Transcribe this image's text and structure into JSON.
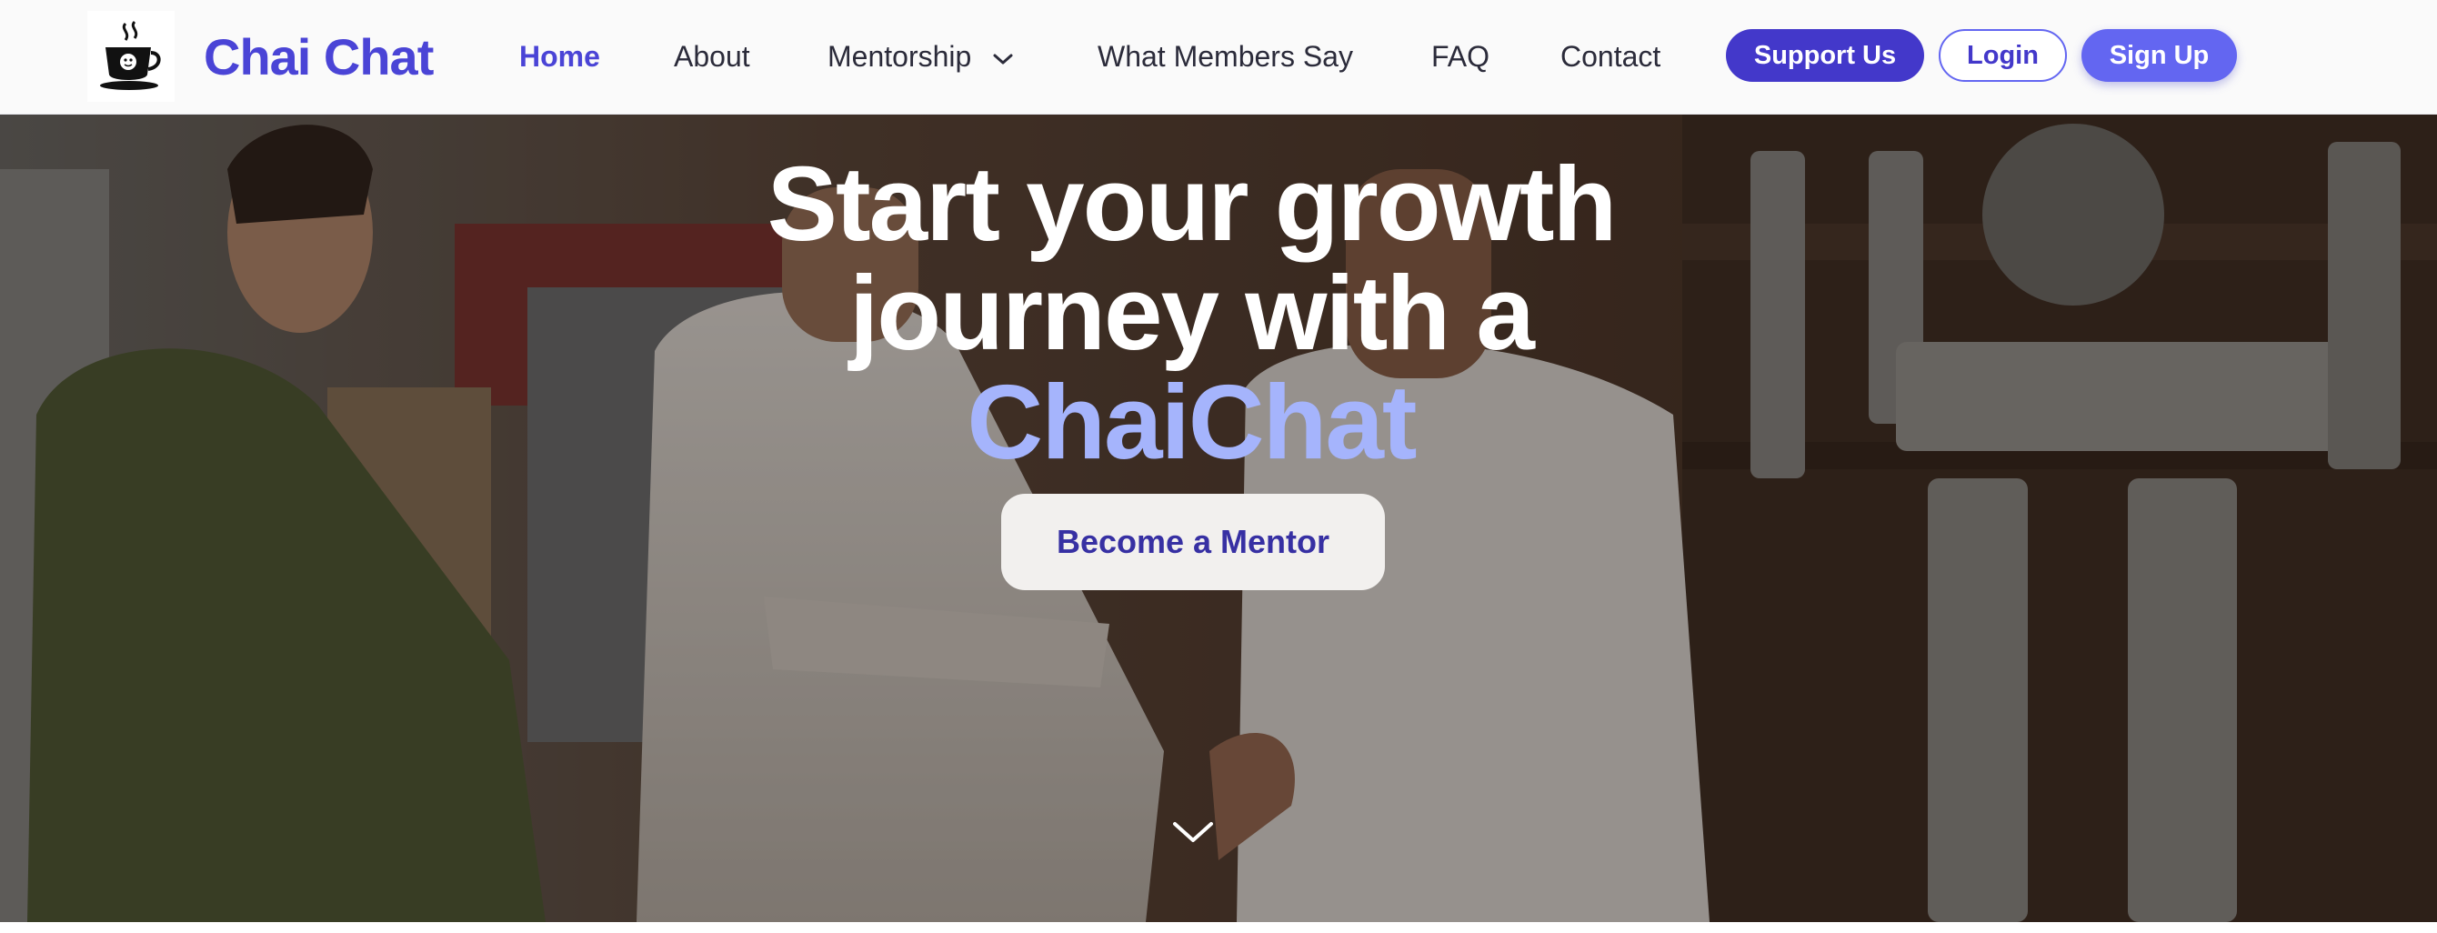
{
  "brand": {
    "name": "Chai Chat",
    "logo_icon": "chai-cup-icon"
  },
  "nav": {
    "links": [
      {
        "label": "Home",
        "active": true
      },
      {
        "label": "About"
      },
      {
        "label": "Mentorship",
        "has_dropdown": true
      },
      {
        "label": "What Members Say"
      },
      {
        "label": "FAQ"
      },
      {
        "label": "Contact"
      }
    ],
    "support_label": "Support Us",
    "login_label": "Login",
    "signup_label": "Sign Up"
  },
  "hero": {
    "title_line1": "Start your growth",
    "title_line2": "journey with a",
    "title_highlight": "ChaiChat",
    "cta_label": "Become a Mentor",
    "scroll_icon": "chevron-down-icon"
  },
  "colors": {
    "brand": "#4a44d6",
    "nav_text": "#2b2b3a",
    "support_bg": "#4338ca",
    "signup_bg": "#6366f1",
    "highlight": "#a5b4fc",
    "cta_bg": "#f2f0ee",
    "cta_text": "#3730a3",
    "hero_text": "#ffffff"
  }
}
